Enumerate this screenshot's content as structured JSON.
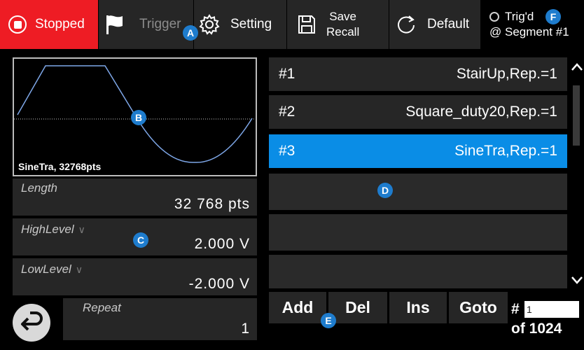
{
  "toolbar": {
    "stop_label": "Stopped",
    "trigger_label": "Trigger",
    "setting_label": "Setting",
    "save_line1": "Save",
    "save_line2": "Recall",
    "default_label": "Default",
    "status_trig": "Trig'd",
    "status_segment": "@ Segment #1"
  },
  "preview": {
    "caption": "SineTra, 32768pts"
  },
  "params": {
    "length_label": "Length",
    "length_value": "32 768 pts",
    "high_label": "HighLevel",
    "high_value": "2.000 V",
    "low_label": "LowLevel",
    "low_value": "-2.000 V",
    "repeat_label": "Repeat",
    "repeat_value": "1"
  },
  "segments": [
    {
      "num": "#1",
      "desc": "StairUp,Rep.=1",
      "selected": false
    },
    {
      "num": "#2",
      "desc": "Square_duty20,Rep.=1",
      "selected": false
    },
    {
      "num": "#3",
      "desc": "SineTra,Rep.=1",
      "selected": true
    }
  ],
  "buttons": {
    "add": "Add",
    "del": "Del",
    "ins": "Ins",
    "goto": "Goto"
  },
  "goto": {
    "hash": "#",
    "input_value": "1",
    "of_text": "of 1024"
  },
  "callouts": {
    "a": "A",
    "b": "B",
    "c": "C",
    "d": "D",
    "e": "E",
    "f": "F"
  },
  "colors": {
    "stop_red": "#ee1c24",
    "selected_blue": "#0a8de6",
    "badge_blue": "#1e7ccd",
    "wave": "#7ea7e8"
  },
  "icons": {
    "stop": "stop-circle-icon",
    "trigger": "flag-icon",
    "setting": "gear-icon",
    "save": "floppy-icon",
    "default": "refresh-icon",
    "back": "back-arrow-icon",
    "up": "chevron-up-icon",
    "down": "chevron-down-icon"
  }
}
